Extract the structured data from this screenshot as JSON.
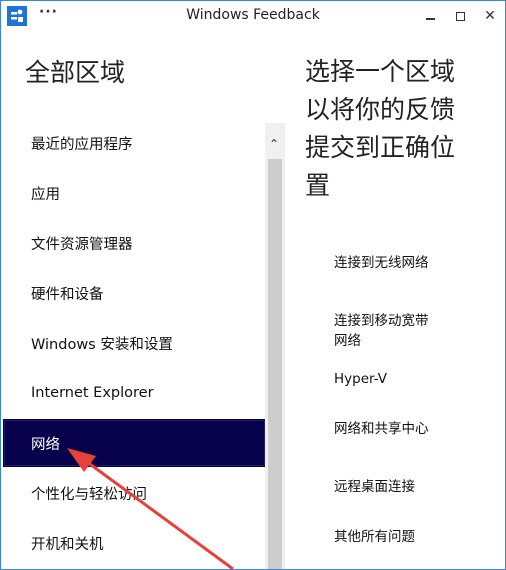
{
  "window": {
    "title": "Windows Feedback",
    "more_label": "···",
    "close_label": "✕"
  },
  "left": {
    "heading": "全部区域",
    "items": [
      {
        "label": "最近的应用程序"
      },
      {
        "label": "应用"
      },
      {
        "label": "文件资源管理器"
      },
      {
        "label": "硬件和设备"
      },
      {
        "label": "Windows 安装和设置"
      },
      {
        "label": "Internet Explorer"
      },
      {
        "label": "网络",
        "selected": true
      },
      {
        "label": "个性化与轻松访问"
      },
      {
        "label": "开机和关机"
      }
    ]
  },
  "scrollbar": {
    "up_arrow": "⌃"
  },
  "right": {
    "heading": "选择一个区域以将你的反馈提交到正确位置",
    "items": [
      {
        "label": "连接到无线网络"
      },
      {
        "label": "连接到移动宽带网络"
      },
      {
        "label": "Hyper-V"
      },
      {
        "label": "网络和共享中心"
      },
      {
        "label": "远程桌面连接"
      },
      {
        "label": "其他所有问题"
      }
    ]
  },
  "colors": {
    "accent": "#1e74d4",
    "selected_bg": "#07004b",
    "annotation_arrow": "#e8413a"
  }
}
